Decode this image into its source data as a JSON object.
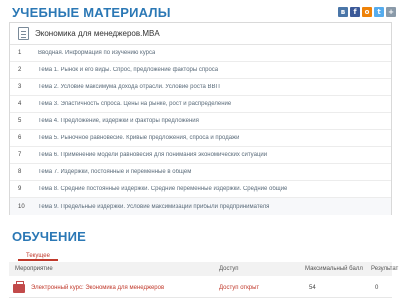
{
  "materials_title": "УЧЕБНЫЕ МАТЕРИАЛЫ",
  "share_icons": [
    {
      "name": "vk-icon",
      "glyph": "в",
      "color": "#4a76a8"
    },
    {
      "name": "facebook-icon",
      "glyph": "f",
      "color": "#3b5998"
    },
    {
      "name": "odnoklassniki-icon",
      "glyph": "о",
      "color": "#ee8208"
    },
    {
      "name": "twitter-icon",
      "glyph": "t",
      "color": "#55acee"
    },
    {
      "name": "share-icon",
      "glyph": "+",
      "color": "#8a9aa9"
    }
  ],
  "course": {
    "name": "Экономика для менеджеров.MBA",
    "modules": [
      {
        "num": "1",
        "title": "Вводная. Информация по изучению курса"
      },
      {
        "num": "2",
        "title": "Тема 1. Рынок и его виды. Спрос, предложение факторы спроса"
      },
      {
        "num": "3",
        "title": "Тема 2. Условие максимума дохода отрасли. Условие роста ВВП"
      },
      {
        "num": "4",
        "title": "Тема 3. Эластичность спроса. Цены на рынке, рост и распределение"
      },
      {
        "num": "5",
        "title": "Тема 4. Предложение, издержки и факторы предложения"
      },
      {
        "num": "6",
        "title": "Тема 5. Рыночное равновесие. Кривые предложения, спроса и продажи"
      },
      {
        "num": "7",
        "title": "Тема 6. Применение модели равновесия для понимания экономических ситуаций"
      },
      {
        "num": "8",
        "title": "Тема 7. Издержки, постоянные и переменные в общем"
      },
      {
        "num": "9",
        "title": "Тема 8. Средние постоянные издержки. Средние переменные издержки. Средние общие"
      },
      {
        "num": "10",
        "title": "Тема 9. Предельные издержки. Условие максимизации прибыли предпринимателя"
      }
    ]
  },
  "training_title": "ОБУЧЕНИЕ",
  "tab_label": "Текущее",
  "table": {
    "headers": [
      "Мероприятие",
      "Доступ",
      "Максимальный балл",
      "Результат"
    ],
    "row": {
      "name": "Электронный курс: Экономика для менеджеров",
      "access": "Доступ открыт",
      "max_score": "54",
      "result": "0"
    }
  }
}
